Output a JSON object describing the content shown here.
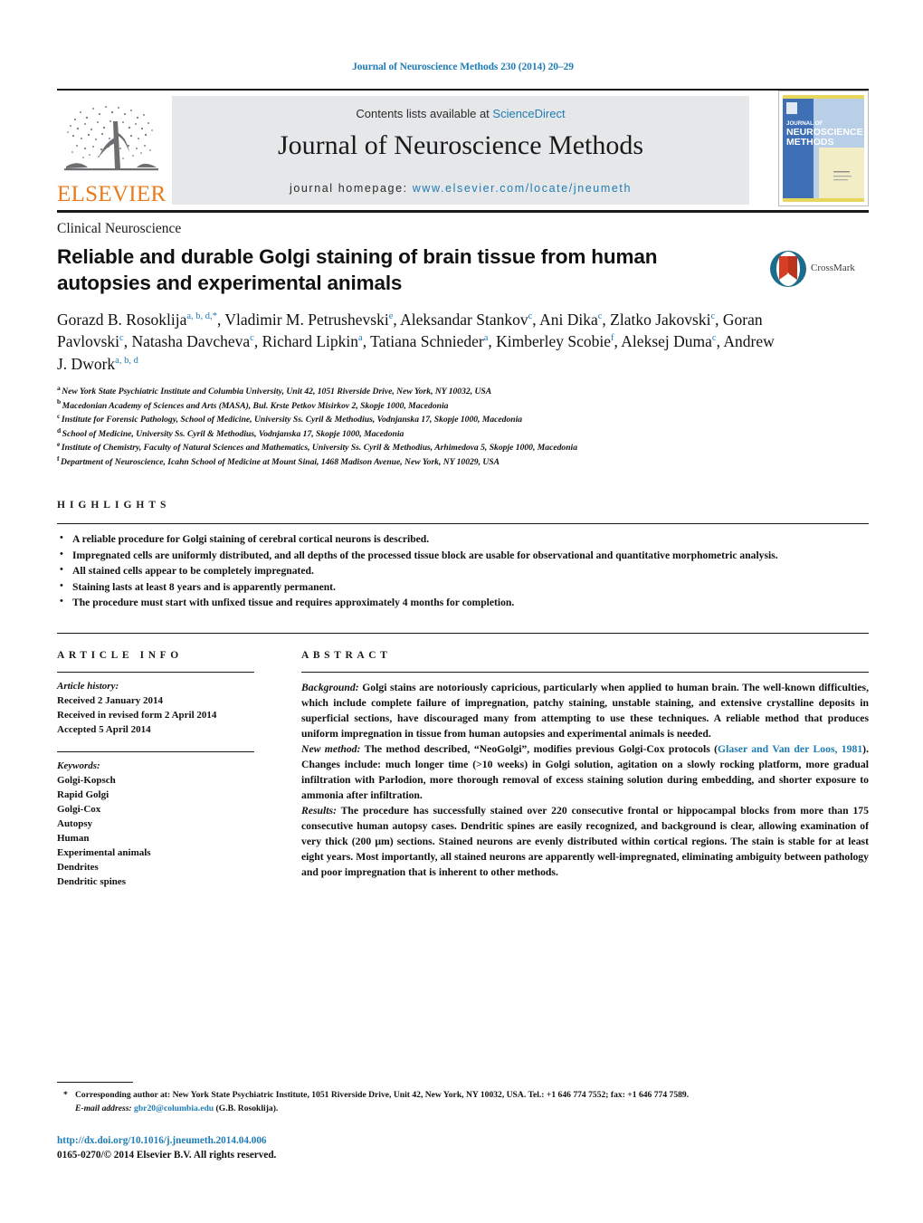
{
  "running_head": "Journal of Neuroscience Methods 230 (2014) 20–29",
  "masthead": {
    "contents_prefix": "Contents lists available at ",
    "sciencedirect": "ScienceDirect",
    "journal_title": "Journal of Neuroscience Methods",
    "homepage_prefix": "journal homepage: ",
    "homepage_url": "www.elsevier.com/locate/jneumeth",
    "publisher": "ELSEVIER",
    "cover_line1": "JOURNAL OF",
    "cover_line2": "NEUROSCIENCE",
    "cover_line3": "METHODS",
    "accent_blue": "#1f7cb4",
    "elsevier_orange": "#e87b1e",
    "banner_gray": "#e6e7e8"
  },
  "article": {
    "section": "Clinical Neuroscience",
    "title": "Reliable and durable Golgi staining of brain tissue from human autopsies and experimental animals",
    "crossmark_label": "CrossMark",
    "authors": [
      {
        "name": "Gorazd B. Rosoklija",
        "marks": "a, b, d,",
        "star": true,
        "sep": ", "
      },
      {
        "name": "Vladimir M. Petrushevski",
        "marks": "e",
        "star": false,
        "sep": ", "
      },
      {
        "name": "Aleksandar Stankov",
        "marks": "c",
        "star": false,
        "sep": ", "
      },
      {
        "name": "Ani Dika",
        "marks": "c",
        "star": false,
        "sep": ", "
      },
      {
        "name": "Zlatko Jakovski",
        "marks": "c",
        "star": false,
        "sep": ", "
      },
      {
        "name": "Goran Pavlovski",
        "marks": "c",
        "star": false,
        "sep": ", "
      },
      {
        "name": "Natasha Davcheva",
        "marks": "c",
        "star": false,
        "sep": ", "
      },
      {
        "name": "Richard Lipkin",
        "marks": "a",
        "star": false,
        "sep": ", "
      },
      {
        "name": "Tatiana Schnieder",
        "marks": "a",
        "star": false,
        "sep": ", "
      },
      {
        "name": "Kimberley Scobie",
        "marks": "f",
        "star": false,
        "sep": ", "
      },
      {
        "name": "Aleksej Duma",
        "marks": "c",
        "star": false,
        "sep": ", "
      },
      {
        "name": "Andrew J. Dwork",
        "marks": "a, b, d",
        "star": false,
        "sep": ""
      }
    ],
    "affiliations": [
      {
        "mark": "a",
        "text": "New York State Psychiatric Institute and Columbia University, Unit 42, 1051 Riverside Drive, New York, NY 10032, USA"
      },
      {
        "mark": "b",
        "text": "Macedonian Academy of Sciences and Arts (MASA), Bul. Krste Petkov Misirkov 2, Skopje 1000, Macedonia"
      },
      {
        "mark": "c",
        "text": "Institute for Forensic Pathology, School of Medicine, University Ss. Cyril & Methodius, Vodnjanska 17, Skopje 1000, Macedonia"
      },
      {
        "mark": "d",
        "text": "School of Medicine, University Ss. Cyril & Methodius, Vodnjanska 17, Skopje 1000, Macedonia"
      },
      {
        "mark": "e",
        "text": "Institute of Chemistry, Faculty of Natural Sciences and Mathematics, University Ss. Cyril & Methodius, Arhimedova 5, Skopje 1000, Macedonia"
      },
      {
        "mark": "f",
        "text": "Department of Neuroscience, Icahn School of Medicine at Mount Sinai, 1468 Madison Avenue, New York, NY 10029, USA"
      }
    ]
  },
  "highlights": {
    "heading": "HIGHLIGHTS",
    "items": [
      "A reliable procedure for Golgi staining of cerebral cortical neurons is described.",
      "Impregnated cells are uniformly distributed, and all depths of the processed tissue block are usable for observational and quantitative morphometric analysis.",
      "All stained cells appear to be completely impregnated.",
      "Staining lasts at least 8 years and is apparently permanent.",
      "The procedure must start with unfixed tissue and requires approximately 4 months for completion."
    ]
  },
  "article_info": {
    "heading": "ARTICLE INFO",
    "history_label": "Article history:",
    "history": [
      "Received 2 January 2014",
      "Received in revised form 2 April 2014",
      "Accepted 5 April 2014"
    ],
    "keywords_label": "Keywords:",
    "keywords": [
      "Golgi-Kopsch",
      "Rapid Golgi",
      "Golgi-Cox",
      "Autopsy",
      "Human",
      "Experimental animals",
      "Dendrites",
      "Dendritic spines"
    ]
  },
  "abstract": {
    "heading": "ABSTRACT",
    "background_label": "Background:",
    "background_text": " Golgi stains are notoriously capricious, particularly when applied to human brain. The well-known difficulties, which include complete failure of impregnation, patchy staining, unstable staining, and extensive crystalline deposits in superficial sections, have discouraged many from attempting to use these techniques. A reliable method that produces uniform impregnation in tissue from human autopsies and experimental animals is needed.",
    "newmethod_label": "New method:",
    "newmethod_text_pre": " The method described, “NeoGolgi”, modifies previous Golgi-Cox protocols (",
    "newmethod_citation": "Glaser and Van der Loos, 1981",
    "newmethod_text_post": "). Changes include: much longer time (>10 weeks) in Golgi solution, agitation on a slowly rocking platform, more gradual infiltration with Parlodion, more thorough removal of excess staining solution during embedding, and shorter exposure to ammonia after infiltration.",
    "results_label": "Results:",
    "results_text": " The procedure has successfully stained over 220 consecutive frontal or hippocampal blocks from more than 175 consecutive human autopsy cases. Dendritic spines are easily recognized, and background is clear, allowing examination of very thick (200 μm) sections. Stained neurons are evenly distributed within cortical regions. The stain is stable for at least eight years. Most importantly, all stained neurons are apparently well-impregnated, eliminating ambiguity between pathology and poor impregnation that is inherent to other methods."
  },
  "footnotes": {
    "corresponding_star": "*",
    "corresponding_text": "Corresponding author at: New York State Psychiatric Institute, 1051 Riverside Drive, Unit 42, New York, NY 10032, USA. Tel.: +1 646 774 7552; fax: +1 646 774 7589.",
    "email_label": "E-mail address:",
    "email": "gbr20@columbia.edu",
    "email_suffix": " (G.B. Rosoklija).",
    "doi": "http://dx.doi.org/10.1016/j.jneumeth.2014.04.006",
    "copyright": "0165-0270/© 2014 Elsevier B.V. All rights reserved."
  }
}
